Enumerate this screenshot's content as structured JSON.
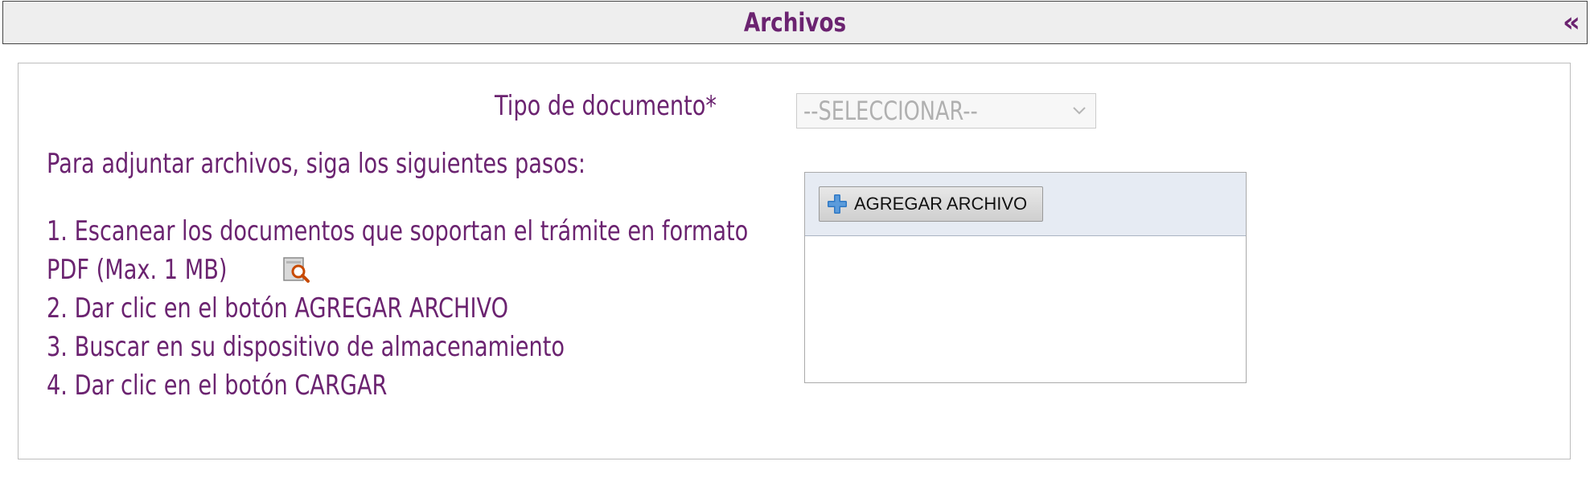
{
  "panel": {
    "title": "Archivos",
    "collapse_glyph": "«"
  },
  "form": {
    "doc_type_label": "Tipo de documento*",
    "doc_type_selected": "--SELECCIONAR--"
  },
  "instructions": {
    "intro": "Para adjuntar archivos, siga los siguientes pasos:",
    "step1_line1": "1. Escanear los documentos que soportan el trámite en formato",
    "step1_line2": "PDF (Max. 1 MB)",
    "step2": "2. Dar clic en el botón AGREGAR ARCHIVO",
    "step3": "3. Buscar en su dispositivo de almacenamiento",
    "step4": "4. Dar clic en el botón CARGAR"
  },
  "uploader": {
    "add_file_label": "AGREGAR ARCHIVO"
  },
  "icons": {
    "pdf_preview": "magnifier-document-icon",
    "add": "plus-icon",
    "dropdown": "chevron-down-icon"
  },
  "colors": {
    "accent": "#6b2370",
    "header_bg": "#eeeeee",
    "toolbar_bg": "#e6ebf3",
    "plus_icon": "#2f78c4"
  }
}
